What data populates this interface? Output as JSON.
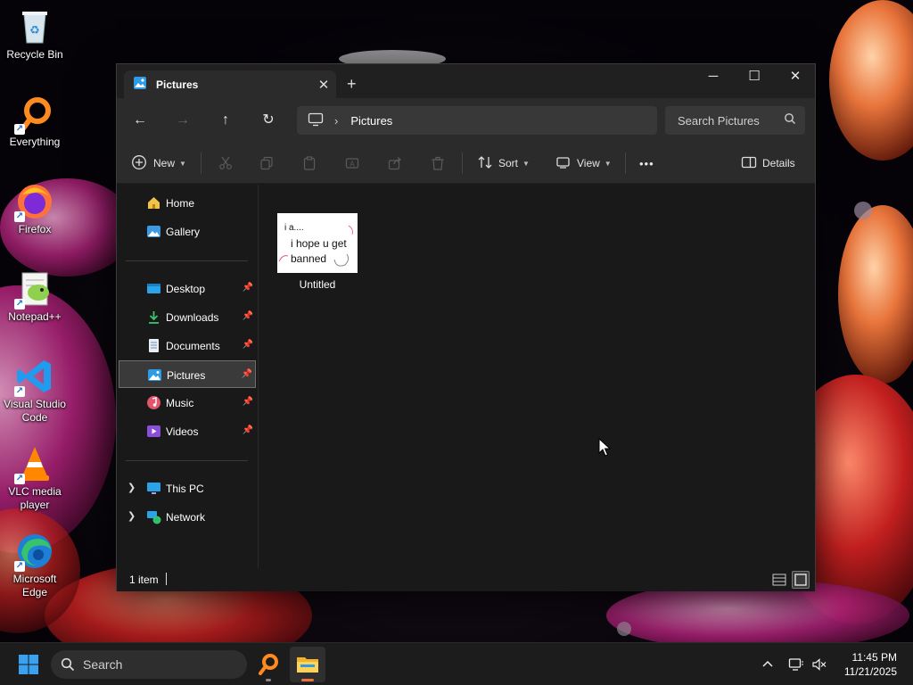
{
  "desktop": {
    "icons": [
      {
        "label": "Recycle Bin",
        "icon": "recycle-bin-icon"
      },
      {
        "label": "Everything",
        "icon": "everything-search-icon"
      },
      {
        "label": "Firefox",
        "icon": "firefox-icon"
      },
      {
        "label": "Notepad++",
        "icon": "notepad-plus-plus-icon"
      },
      {
        "label": "Visual Studio Code",
        "icon": "vscode-icon"
      },
      {
        "label": "VLC media player",
        "icon": "vlc-icon"
      },
      {
        "label": "Microsoft Edge",
        "icon": "edge-icon"
      }
    ]
  },
  "explorer": {
    "tab_title": "Pictures",
    "tab_close": "✕",
    "new_tab": "+",
    "window_controls": {
      "minimize": "─",
      "maximize": "☐",
      "close": "✕"
    },
    "address": {
      "location": "Pictures",
      "separator": "›"
    },
    "search_placeholder": "Search Pictures",
    "command_bar": {
      "new_label": "New",
      "sort_label": "Sort",
      "view_label": "View",
      "more_label": "•••",
      "details_label": "Details"
    },
    "sidebar": {
      "top_items": [
        {
          "label": "Home",
          "icon": "home-icon"
        },
        {
          "label": "Gallery",
          "icon": "gallery-icon"
        }
      ],
      "quick_access": [
        {
          "label": "Desktop",
          "icon": "desktop-folder-icon",
          "pinned": true
        },
        {
          "label": "Downloads",
          "icon": "downloads-folder-icon",
          "pinned": true
        },
        {
          "label": "Documents",
          "icon": "documents-folder-icon",
          "pinned": true
        },
        {
          "label": "Pictures",
          "icon": "pictures-folder-icon",
          "pinned": true,
          "selected": true
        },
        {
          "label": "Music",
          "icon": "music-folder-icon",
          "pinned": true
        },
        {
          "label": "Videos",
          "icon": "videos-folder-icon",
          "pinned": true
        }
      ],
      "locations": [
        {
          "label": "This PC",
          "icon": "this-pc-icon"
        },
        {
          "label": "Network",
          "icon": "network-icon"
        }
      ]
    },
    "files": [
      {
        "name": "Untitled",
        "thumbnail_lines": [
          "i a....",
          "i hope u get",
          "banned"
        ]
      }
    ],
    "status": {
      "item_count": "1 item"
    }
  },
  "taskbar": {
    "search_placeholder": "Search",
    "clock": {
      "time": "11:45 PM",
      "date": "11/21/2025"
    },
    "tray_chevron": "^"
  },
  "colors": {
    "accent": "#e8743b",
    "window_bg": "#191919",
    "toolbar_bg": "#2b2b2b",
    "selection_border": "#6e6e6e"
  }
}
